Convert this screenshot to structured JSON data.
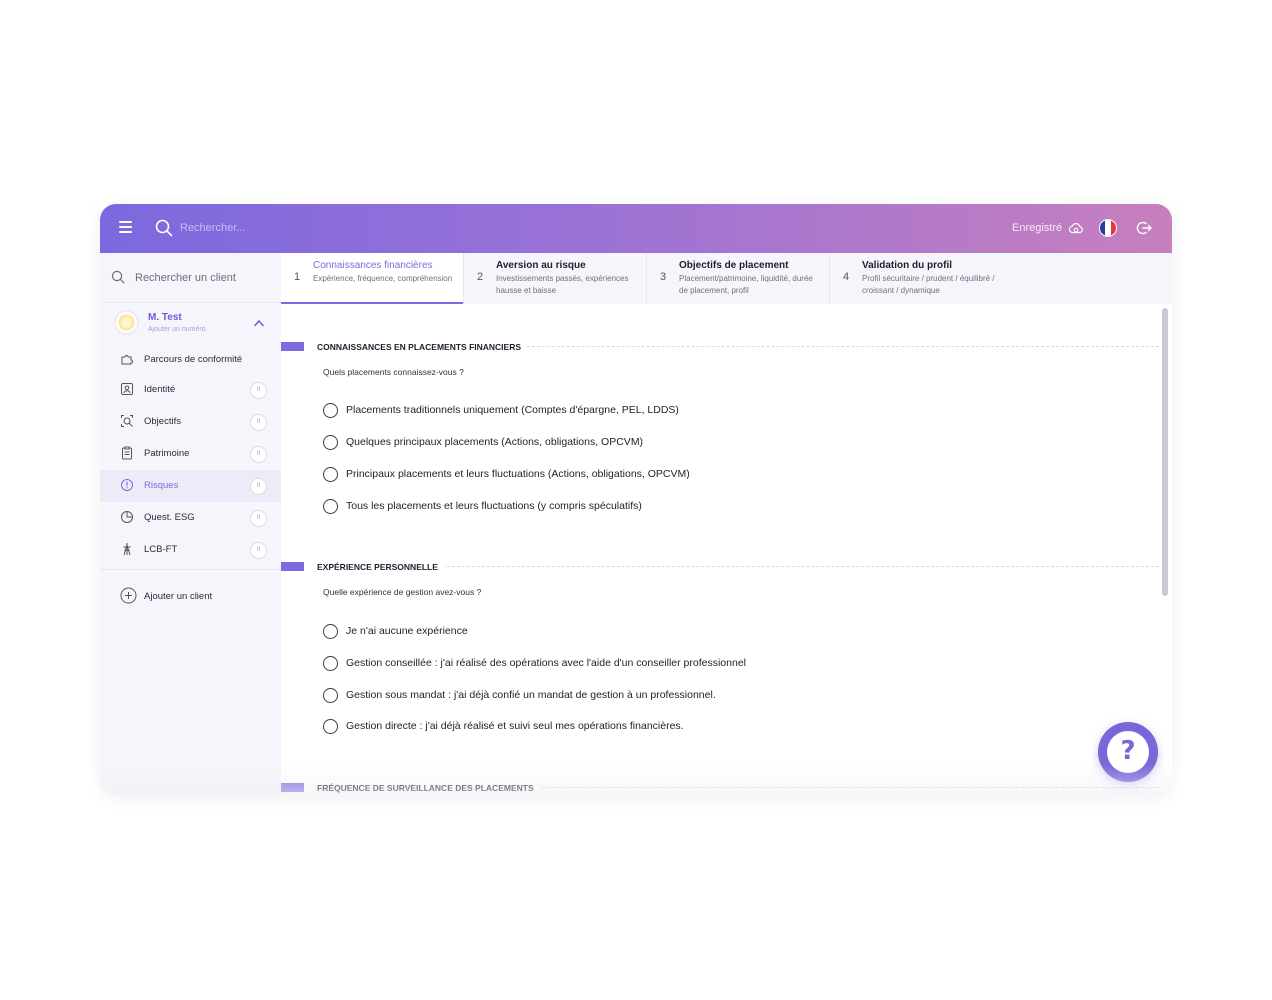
{
  "header": {
    "search_placeholder": "Rechercher...",
    "saved_label": "Enregistré"
  },
  "sidebar": {
    "client_search_placeholder": "Rechercher un client",
    "client": {
      "name": "M. Test",
      "subtitle": "Ajouter un numéro"
    },
    "items": [
      {
        "label": "Parcours de conformité",
        "icon": "puzzle-icon"
      },
      {
        "label": "Identité",
        "icon": "id-card-icon",
        "count": "0"
      },
      {
        "label": "Objectifs",
        "icon": "target-search-icon",
        "count": "0"
      },
      {
        "label": "Patrimoine",
        "icon": "clipboard-icon",
        "count": "0"
      },
      {
        "label": "Risques",
        "icon": "alert-icon",
        "count": "0",
        "active": true
      },
      {
        "label": "Quest. ESG",
        "icon": "pie-icon",
        "count": "0"
      },
      {
        "label": "LCB-FT",
        "icon": "tower-icon",
        "count": "0"
      }
    ],
    "add_client_label": "Ajouter un client"
  },
  "steps": [
    {
      "num": "1",
      "title": "Connaissances financières",
      "desc": "Expérience, fréquence, compréhension",
      "active": true
    },
    {
      "num": "2",
      "title": "Aversion au risque",
      "desc": "Investissements passés, expériences hausse et baisse"
    },
    {
      "num": "3",
      "title": "Objectifs de placement",
      "desc": "Placement/patrimoine, liquidité, durée de placement, profil"
    },
    {
      "num": "4",
      "title": "Validation du profil",
      "desc": "Profil sécuritaire / prudent / équilibré / croissant / dynamique"
    }
  ],
  "sections": [
    {
      "title": "CONNAISSANCES EN PLACEMENTS FINANCIERS",
      "question": "Quels placements connaissez-vous ?",
      "options": [
        "Placements traditionnels uniquement (Comptes d'épargne, PEL, LDDS)",
        "Quelques principaux placements (Actions, obligations, OPCVM)",
        "Principaux placements et leurs fluctuations (Actions, obligations, OPCVM)",
        "Tous les placements et leurs fluctuations (y compris spéculatifs)"
      ]
    },
    {
      "title": "EXPÉRIENCE PERSONNELLE",
      "question": "Quelle expérience de gestion avez-vous ?",
      "options": [
        "Je n'ai aucune expérience",
        "Gestion conseillée : j'ai réalisé des opérations avec l'aide d'un conseiller professionnel",
        "Gestion sous mandat : j'ai déjà confié un mandat de gestion à un professionnel.",
        "Gestion directe : j'ai déjà réalisé et suivi seul mes opérations financières."
      ]
    },
    {
      "title": "FRÉQUENCE DE SURVEILLANCE DES PLACEMENTS"
    }
  ],
  "colors": {
    "accent": "#7d6ae0",
    "header_gradient_start": "#7c68de",
    "header_gradient_end": "#c77fbe"
  }
}
